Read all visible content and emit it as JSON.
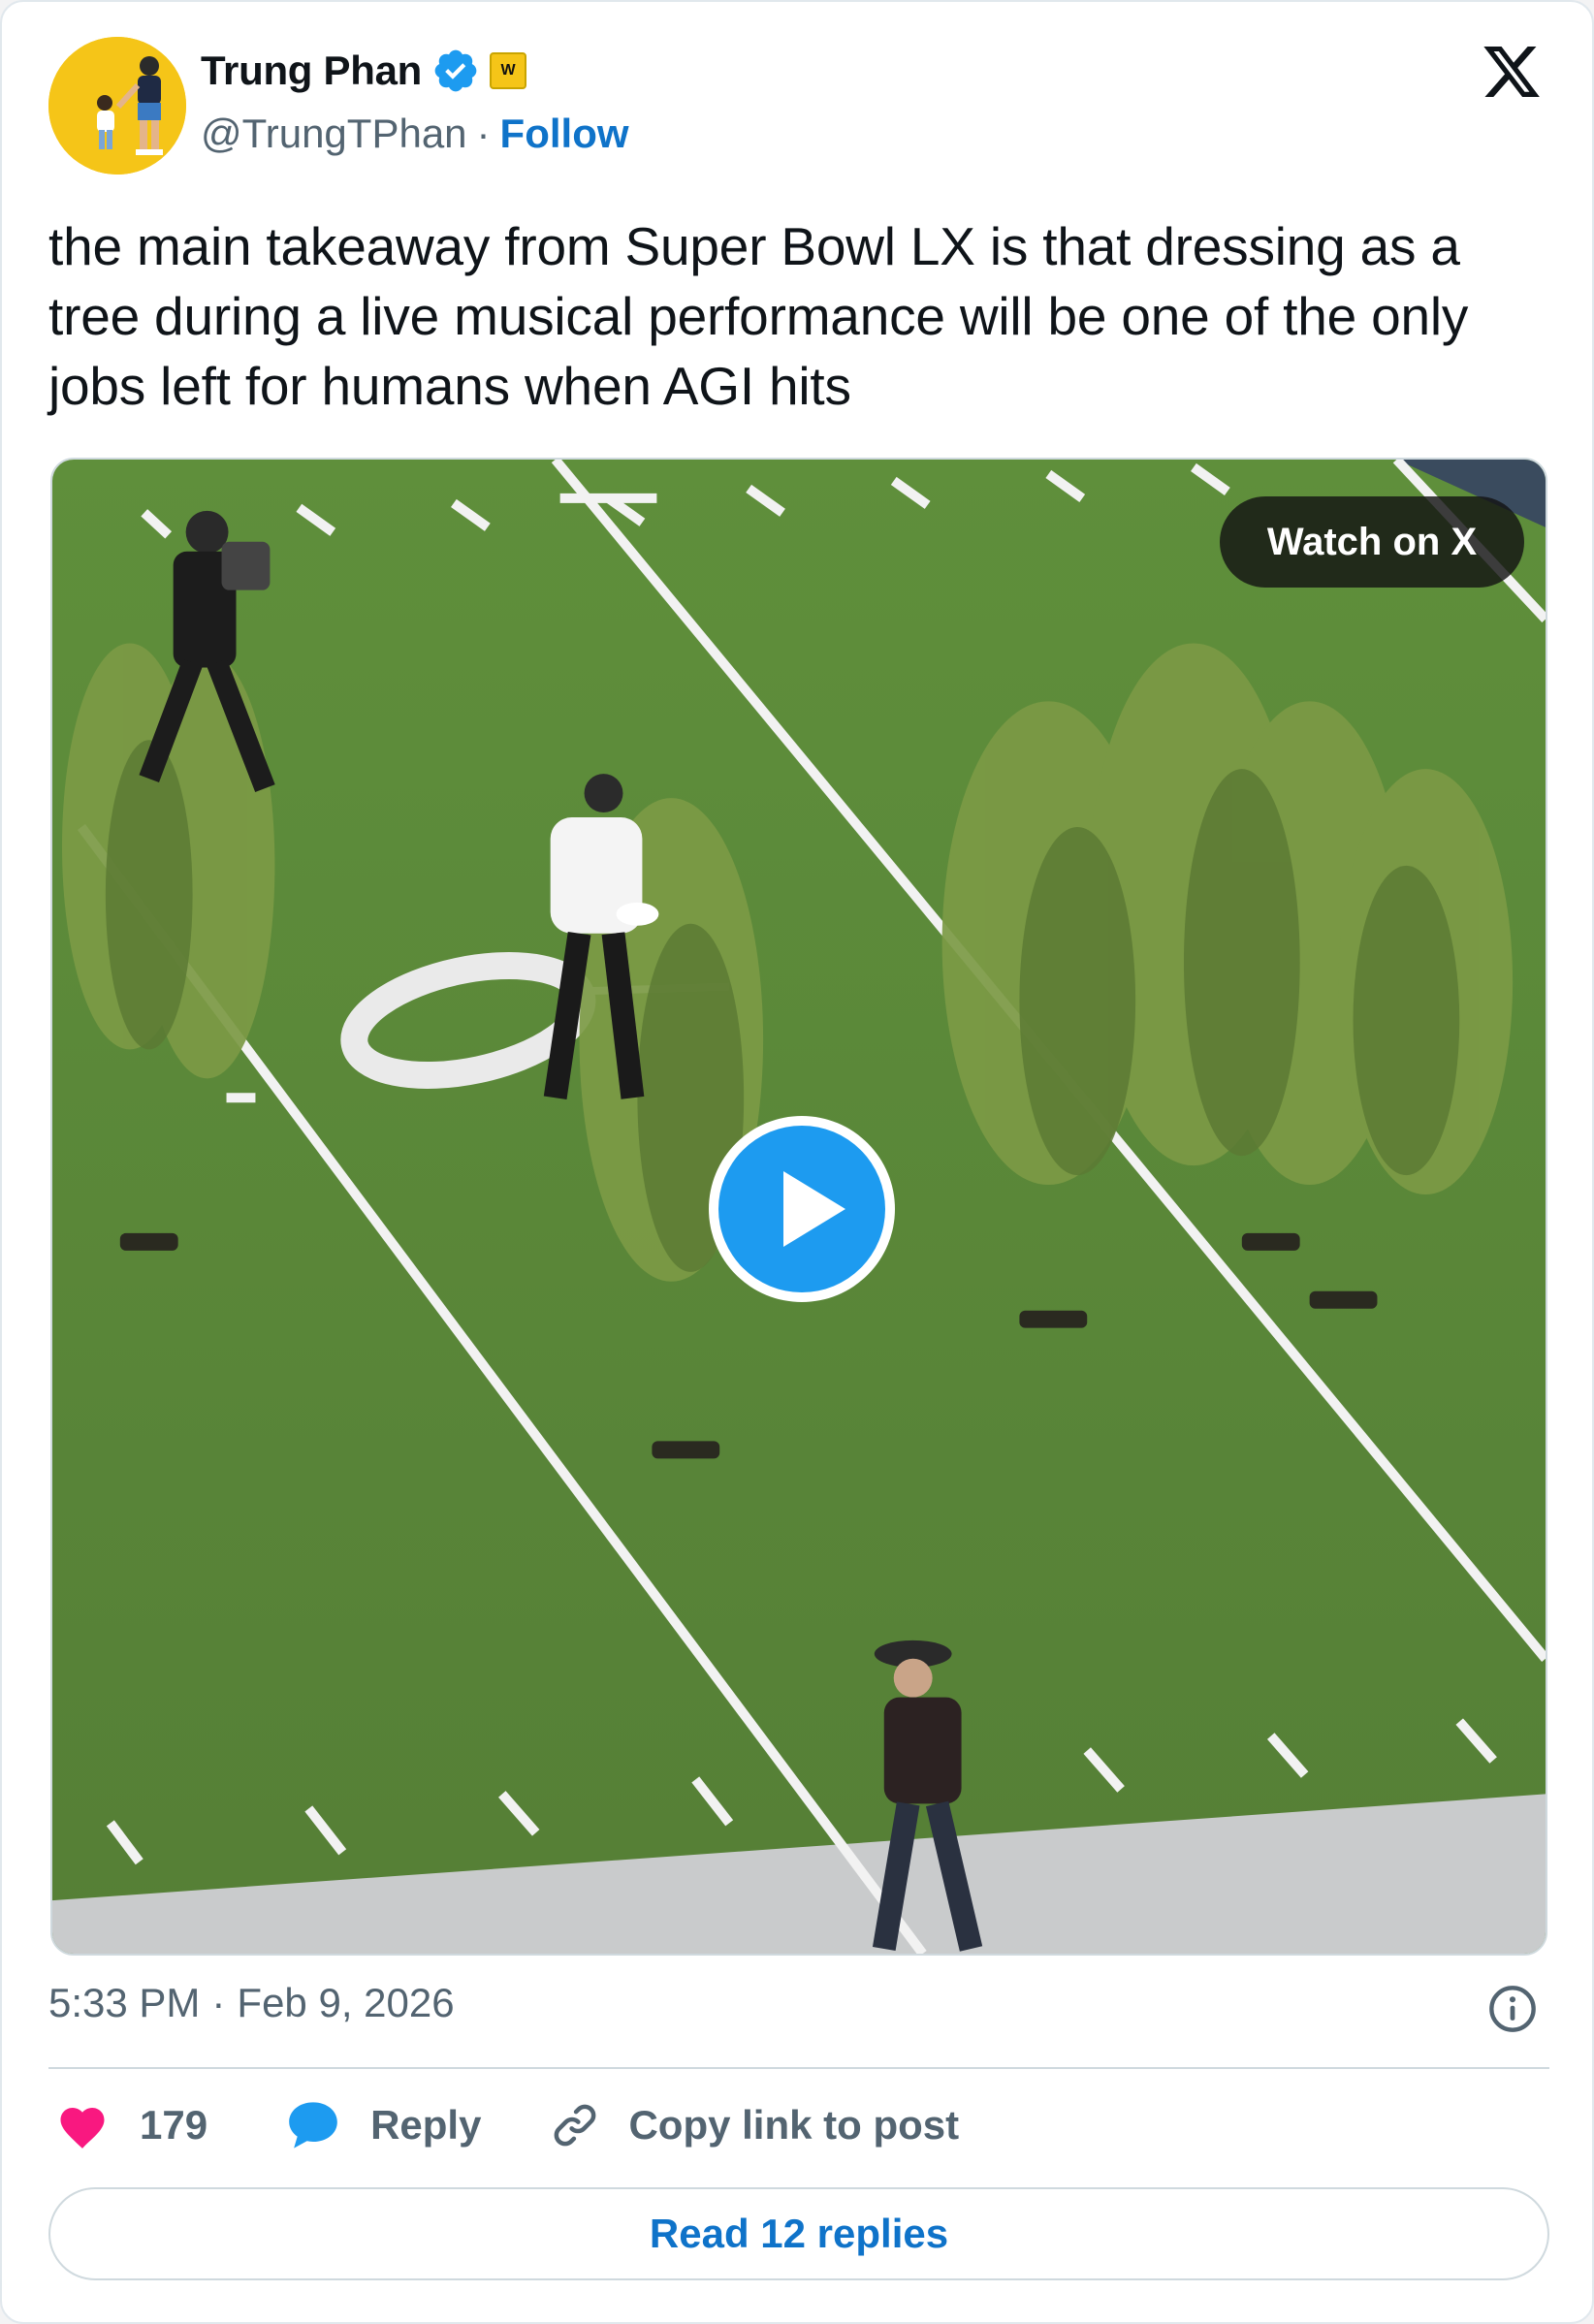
{
  "author": {
    "name": "Trung Phan",
    "handle": "@TrungTPhan",
    "separator": "·",
    "follow_label": "Follow",
    "affiliation_badge": "W"
  },
  "tweet": {
    "text": "the main takeaway from Super Bowl LX is that dressing as a tree during a live musical performance will be one of the only jobs left for humans when AGI hits"
  },
  "media": {
    "watch_label": "Watch on X",
    "play_icon": "play-icon",
    "field_marking": "0"
  },
  "meta": {
    "time": "5:33 PM",
    "separator": "·",
    "date": "Feb 9, 2026",
    "info_icon": "info-icon"
  },
  "actions": {
    "likes": "179",
    "reply_label": "Reply",
    "copy_label": "Copy link to post"
  },
  "footer": {
    "read_replies_label": "Read 12 replies"
  },
  "colors": {
    "accent": "#0f73c9",
    "verified": "#1d9bf0",
    "like": "#f91880",
    "reply": "#1d9bf0",
    "muted": "#536471",
    "field_green": "#5e8b3a",
    "avatar_bg": "#f5c518"
  }
}
